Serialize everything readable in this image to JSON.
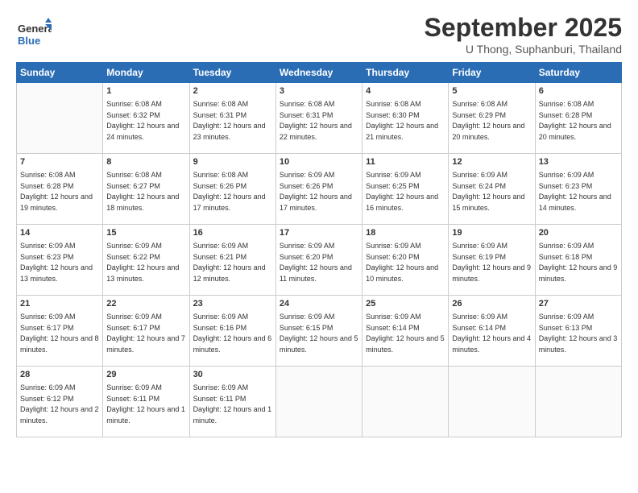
{
  "header": {
    "logo_general": "General",
    "logo_blue": "Blue",
    "month_title": "September 2025",
    "subtitle": "U Thong, Suphanburi, Thailand"
  },
  "days_of_week": [
    "Sunday",
    "Monday",
    "Tuesday",
    "Wednesday",
    "Thursday",
    "Friday",
    "Saturday"
  ],
  "weeks": [
    [
      {
        "day": "",
        "empty": true
      },
      {
        "day": "1",
        "sunrise": "Sunrise: 6:08 AM",
        "sunset": "Sunset: 6:32 PM",
        "daylight": "Daylight: 12 hours and 24 minutes."
      },
      {
        "day": "2",
        "sunrise": "Sunrise: 6:08 AM",
        "sunset": "Sunset: 6:31 PM",
        "daylight": "Daylight: 12 hours and 23 minutes."
      },
      {
        "day": "3",
        "sunrise": "Sunrise: 6:08 AM",
        "sunset": "Sunset: 6:31 PM",
        "daylight": "Daylight: 12 hours and 22 minutes."
      },
      {
        "day": "4",
        "sunrise": "Sunrise: 6:08 AM",
        "sunset": "Sunset: 6:30 PM",
        "daylight": "Daylight: 12 hours and 21 minutes."
      },
      {
        "day": "5",
        "sunrise": "Sunrise: 6:08 AM",
        "sunset": "Sunset: 6:29 PM",
        "daylight": "Daylight: 12 hours and 20 minutes."
      },
      {
        "day": "6",
        "sunrise": "Sunrise: 6:08 AM",
        "sunset": "Sunset: 6:28 PM",
        "daylight": "Daylight: 12 hours and 20 minutes."
      }
    ],
    [
      {
        "day": "7",
        "sunrise": "Sunrise: 6:08 AM",
        "sunset": "Sunset: 6:28 PM",
        "daylight": "Daylight: 12 hours and 19 minutes."
      },
      {
        "day": "8",
        "sunrise": "Sunrise: 6:08 AM",
        "sunset": "Sunset: 6:27 PM",
        "daylight": "Daylight: 12 hours and 18 minutes."
      },
      {
        "day": "9",
        "sunrise": "Sunrise: 6:08 AM",
        "sunset": "Sunset: 6:26 PM",
        "daylight": "Daylight: 12 hours and 17 minutes."
      },
      {
        "day": "10",
        "sunrise": "Sunrise: 6:09 AM",
        "sunset": "Sunset: 6:26 PM",
        "daylight": "Daylight: 12 hours and 17 minutes."
      },
      {
        "day": "11",
        "sunrise": "Sunrise: 6:09 AM",
        "sunset": "Sunset: 6:25 PM",
        "daylight": "Daylight: 12 hours and 16 minutes."
      },
      {
        "day": "12",
        "sunrise": "Sunrise: 6:09 AM",
        "sunset": "Sunset: 6:24 PM",
        "daylight": "Daylight: 12 hours and 15 minutes."
      },
      {
        "day": "13",
        "sunrise": "Sunrise: 6:09 AM",
        "sunset": "Sunset: 6:23 PM",
        "daylight": "Daylight: 12 hours and 14 minutes."
      }
    ],
    [
      {
        "day": "14",
        "sunrise": "Sunrise: 6:09 AM",
        "sunset": "Sunset: 6:23 PM",
        "daylight": "Daylight: 12 hours and 13 minutes."
      },
      {
        "day": "15",
        "sunrise": "Sunrise: 6:09 AM",
        "sunset": "Sunset: 6:22 PM",
        "daylight": "Daylight: 12 hours and 13 minutes."
      },
      {
        "day": "16",
        "sunrise": "Sunrise: 6:09 AM",
        "sunset": "Sunset: 6:21 PM",
        "daylight": "Daylight: 12 hours and 12 minutes."
      },
      {
        "day": "17",
        "sunrise": "Sunrise: 6:09 AM",
        "sunset": "Sunset: 6:20 PM",
        "daylight": "Daylight: 12 hours and 11 minutes."
      },
      {
        "day": "18",
        "sunrise": "Sunrise: 6:09 AM",
        "sunset": "Sunset: 6:20 PM",
        "daylight": "Daylight: 12 hours and 10 minutes."
      },
      {
        "day": "19",
        "sunrise": "Sunrise: 6:09 AM",
        "sunset": "Sunset: 6:19 PM",
        "daylight": "Daylight: 12 hours and 9 minutes."
      },
      {
        "day": "20",
        "sunrise": "Sunrise: 6:09 AM",
        "sunset": "Sunset: 6:18 PM",
        "daylight": "Daylight: 12 hours and 9 minutes."
      }
    ],
    [
      {
        "day": "21",
        "sunrise": "Sunrise: 6:09 AM",
        "sunset": "Sunset: 6:17 PM",
        "daylight": "Daylight: 12 hours and 8 minutes."
      },
      {
        "day": "22",
        "sunrise": "Sunrise: 6:09 AM",
        "sunset": "Sunset: 6:17 PM",
        "daylight": "Daylight: 12 hours and 7 minutes."
      },
      {
        "day": "23",
        "sunrise": "Sunrise: 6:09 AM",
        "sunset": "Sunset: 6:16 PM",
        "daylight": "Daylight: 12 hours and 6 minutes."
      },
      {
        "day": "24",
        "sunrise": "Sunrise: 6:09 AM",
        "sunset": "Sunset: 6:15 PM",
        "daylight": "Daylight: 12 hours and 5 minutes."
      },
      {
        "day": "25",
        "sunrise": "Sunrise: 6:09 AM",
        "sunset": "Sunset: 6:14 PM",
        "daylight": "Daylight: 12 hours and 5 minutes."
      },
      {
        "day": "26",
        "sunrise": "Sunrise: 6:09 AM",
        "sunset": "Sunset: 6:14 PM",
        "daylight": "Daylight: 12 hours and 4 minutes."
      },
      {
        "day": "27",
        "sunrise": "Sunrise: 6:09 AM",
        "sunset": "Sunset: 6:13 PM",
        "daylight": "Daylight: 12 hours and 3 minutes."
      }
    ],
    [
      {
        "day": "28",
        "sunrise": "Sunrise: 6:09 AM",
        "sunset": "Sunset: 6:12 PM",
        "daylight": "Daylight: 12 hours and 2 minutes."
      },
      {
        "day": "29",
        "sunrise": "Sunrise: 6:09 AM",
        "sunset": "Sunset: 6:11 PM",
        "daylight": "Daylight: 12 hours and 1 minute."
      },
      {
        "day": "30",
        "sunrise": "Sunrise: 6:09 AM",
        "sunset": "Sunset: 6:11 PM",
        "daylight": "Daylight: 12 hours and 1 minute."
      },
      {
        "day": "",
        "empty": true
      },
      {
        "day": "",
        "empty": true
      },
      {
        "day": "",
        "empty": true
      },
      {
        "day": "",
        "empty": true
      }
    ]
  ]
}
